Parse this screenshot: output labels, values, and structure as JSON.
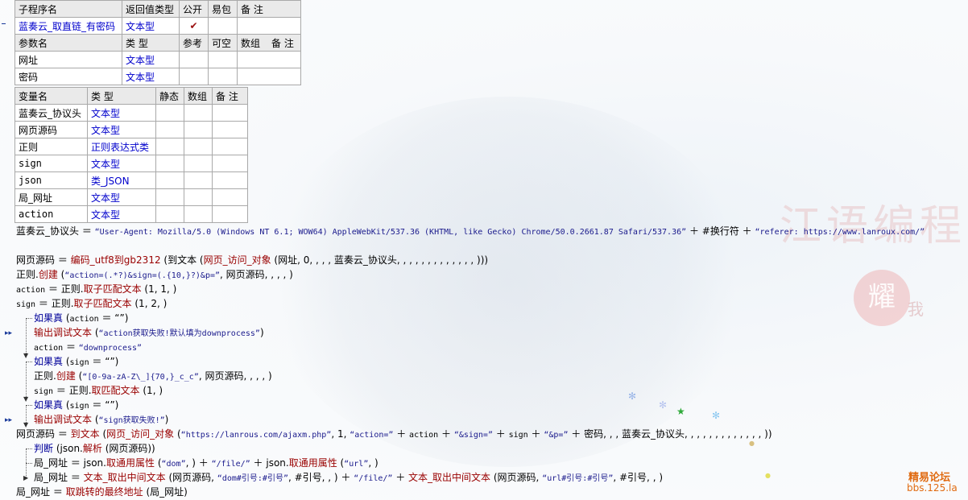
{
  "sub_table": {
    "headers": [
      "子程序名",
      "返回值类型",
      "公开",
      "易包",
      "备 注"
    ],
    "row": {
      "name": "蓝奏云_取直链_有密码",
      "type": "文本型",
      "public_mark": "✔",
      "epkg": "",
      "note": ""
    }
  },
  "param_table": {
    "headers": [
      "参数名",
      "类 型",
      "参考",
      "可空",
      "数组",
      "备 注"
    ],
    "rows": [
      {
        "name": "网址",
        "type": "文本型"
      },
      {
        "name": "密码",
        "type": "文本型"
      }
    ]
  },
  "var_table": {
    "headers": [
      "变量名",
      "类 型",
      "静态",
      "数组",
      "备 注"
    ],
    "rows": [
      {
        "name": "蓝奏云_协议头",
        "type": "文本型"
      },
      {
        "name": "网页源码",
        "type": "文本型"
      },
      {
        "name": "正则",
        "type": "正则表达式类"
      },
      {
        "name": "sign",
        "type": "文本型"
      },
      {
        "name": "json",
        "type": "类_JSON"
      },
      {
        "name": "局_网址",
        "type": "文本型"
      },
      {
        "name": "action",
        "type": "文本型"
      }
    ]
  },
  "code": {
    "l1": {
      "a": "蓝奏云_协议头 ＝ ",
      "b": "“User-Agent: Mozilla/5.0 (Windows NT 6.1; WOW64) AppleWebKit/537.36 (KHTML, like Gecko) Chrome/50.0.2661.87 Safari/537.36”",
      "c": " ＋ #换行符 ＋ ",
      "d": "“referer: https://www.lanroux.com/”"
    },
    "l2": {
      "a": "网页源码 ＝ ",
      "f": "编码_utf8到gb2312",
      "b": " (到文本 (",
      "g": "网页_访问_对象",
      "c": " (网址, 0, , , , 蓝奏云_协议头, , , , , , , , , , , , , )))"
    },
    "l3": {
      "a": "正则.",
      "f": "创建",
      "b": " (",
      "s": "“action=(.*?)&sign=(.{10,}?)&p=”",
      "c": ", 网页源码, , , , )"
    },
    "l4": {
      "m": "action",
      "a": " ＝ 正则.",
      "f": "取子匹配文本",
      "c": " (1, 1, )"
    },
    "l5": {
      "m": "sign",
      "a": " ＝ 正则.",
      "f": "取子匹配文本",
      "c": " (1, 2, )"
    },
    "l6": {
      "k": "如果真",
      "a": " (",
      "m": "action",
      "c": " ＝ “”)"
    },
    "l7": {
      "f": "输出调试文本",
      "a": " (",
      "s": "“action获取失败!默认填为downprocess”",
      "c": ")"
    },
    "l8": {
      "m": "action",
      "a": " ＝ ",
      "s": "“downprocess”"
    },
    "l9": {
      "k": "如果真",
      "a": " (",
      "m": "sign",
      "c": " ＝ “”)"
    },
    "l10": {
      "a": "正则.",
      "f": "创建",
      "b": " (",
      "s": "“[0-9a-zA-Z\\_]{70,}_c_c”",
      "c": ", 网页源码, , , , )"
    },
    "l11": {
      "m": "sign",
      "a": " ＝ 正则.",
      "f": "取匹配文本",
      "c": " (1, )"
    },
    "l12": {
      "k": "如果真",
      "a": " (",
      "m": "sign",
      "c": " ＝ “”)"
    },
    "l13": {
      "f": "输出调试文本",
      "a": " (",
      "s": "“sign获取失败!”",
      "c": ")"
    },
    "l14": {
      "a": "网页源码 ＝ ",
      "f": "到文本",
      "b": " (",
      "g": "网页_访问_对象",
      "c1": " (",
      "s1": "“https://lanrous.com/ajaxm.php”",
      "c2": ", 1, ",
      "s2": "“action=”",
      "c3": " ＋ ",
      "m1": "action",
      "c4": " ＋ ",
      "s3": "“&sign=”",
      "c5": " ＋ ",
      "m2": "sign",
      "c6": " ＋ ",
      "s4": "“&p=”",
      "c7": " ＋ 密码, , , 蓝奏云_协议头, , , , , , , , , , , , , ))"
    },
    "l15": {
      "k": "判断",
      "a": " (json.",
      "f": "解析",
      "c": " (网页源码))"
    },
    "l16": {
      "a": "局_网址 ＝ json.",
      "f": "取通用属性",
      "b": " (",
      "s": "“dom”",
      "c": ", ) ＋ ",
      "s2": "“/file/”",
      "c2": " ＋ json.",
      "f2": "取通用属性",
      "c3": " (",
      "s3": "“url”",
      "c4": ", )"
    },
    "l17": {
      "a": "局_网址 ＝ ",
      "f": "文本_取出中间文本",
      "b": " (网页源码, ",
      "s": "“dom#引号:#引号”",
      "c": ", #引号, , ) ＋ ",
      "s2": "“/file/”",
      "c2": " ＋ ",
      "f2": "文本_取出中间文本",
      "c3": " (网页源码, ",
      "s3": "“url#引号:#引号”",
      "c4": ", #引号, , )"
    },
    "l18": {
      "a": "局_网址 ＝ ",
      "f": "取跳转的最终地址",
      "c": " (局_网址)"
    }
  },
  "markers": {
    "arrow": "▸▸"
  },
  "watermark": {
    "title": "江语编程",
    "seal": "耀",
    "seal_small": "我"
  },
  "logo": {
    "name": "精易论坛",
    "url": "bbs.125.la"
  },
  "colors": {
    "string": "#1a1a8c",
    "command": "#990000",
    "keyword": "#000099",
    "type": "#0000cc",
    "logo": "#e06a10"
  }
}
